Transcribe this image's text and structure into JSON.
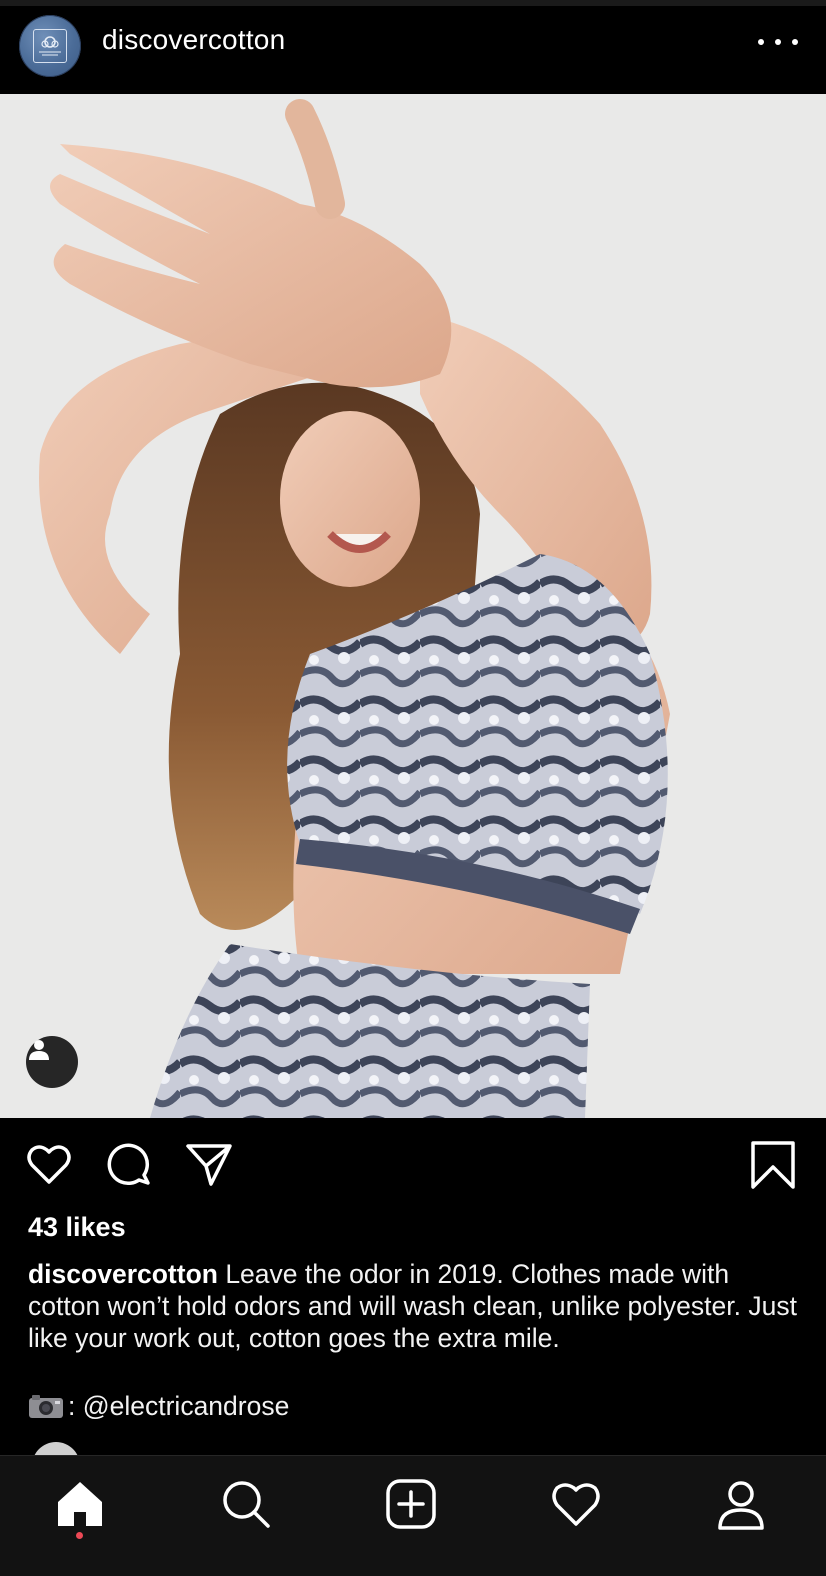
{
  "post": {
    "username": "discovercotton",
    "likes": "43 likes",
    "caption_user": "discovercotton",
    "caption_text": " Leave the odor in 2019. Clothes made with cotton won’t hold odors and will wash clean, unlike polyester. Just like your work out, cotton goes the extra mile.",
    "credit_text": ": @electricandrose"
  },
  "icons": {
    "header": [
      "cotton-logo-avatar",
      "more-options-icon"
    ],
    "actions": [
      "heart-icon",
      "comment-icon",
      "share-icon",
      "bookmark-icon"
    ],
    "photo": [
      "tagged-user-icon"
    ],
    "caption": [
      "camera-emoji"
    ],
    "nav": [
      "home-icon",
      "search-icon",
      "new-post-icon",
      "activity-heart-icon",
      "profile-icon"
    ]
  },
  "colors": {
    "background": "#000000",
    "nav_background": "#121212",
    "notification_dot": "#ed4956"
  }
}
